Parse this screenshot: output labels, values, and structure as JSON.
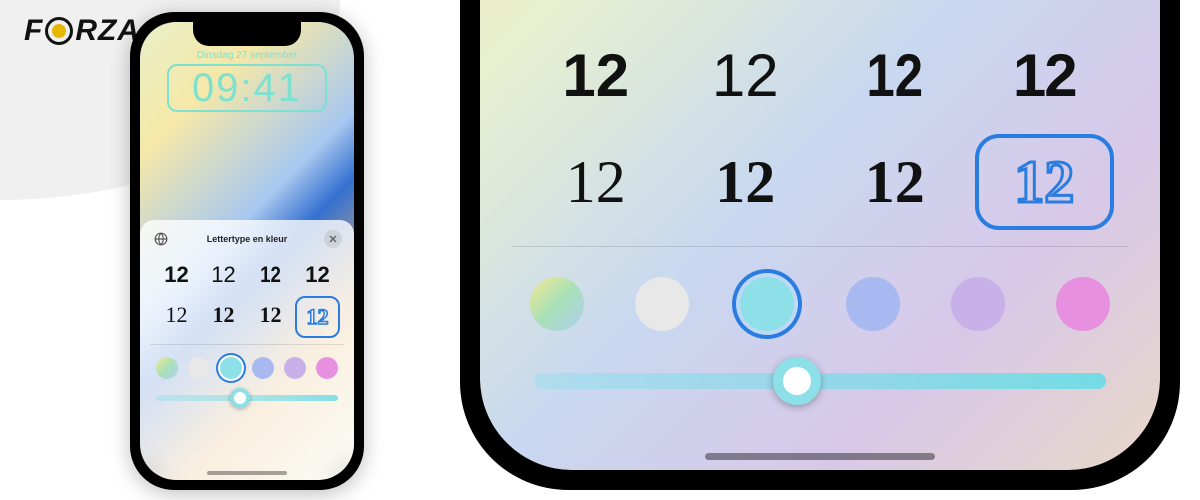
{
  "brand": {
    "pre": "F",
    "post": "RZA"
  },
  "lock": {
    "date": "Dinsdag 27 september",
    "time": "09:41"
  },
  "sheet": {
    "title": "Lettertype en kleur",
    "sample": "12",
    "font_options": [
      {
        "style": "bold",
        "selected": false
      },
      {
        "style": "thin",
        "selected": false
      },
      {
        "style": "cond",
        "selected": false
      },
      {
        "style": "stencil",
        "selected": false
      },
      {
        "style": "serif",
        "selected": false
      },
      {
        "style": "serif-bold",
        "selected": false
      },
      {
        "style": "slab",
        "selected": false
      },
      {
        "style": "outline",
        "selected": true
      }
    ],
    "colors": [
      {
        "css": "linear-gradient(135deg,#f5e890,#a8e0b8,#b0d0f0)",
        "selected": false
      },
      {
        "css": "#e8e8e8",
        "selected": false
      },
      {
        "css": "#8ee0e8",
        "selected": true
      },
      {
        "css": "#a8b8f0",
        "selected": false
      },
      {
        "css": "#c8b0e8",
        "selected": false
      },
      {
        "css": "#e890e0",
        "selected": false
      }
    ],
    "slider_percent": 46
  }
}
